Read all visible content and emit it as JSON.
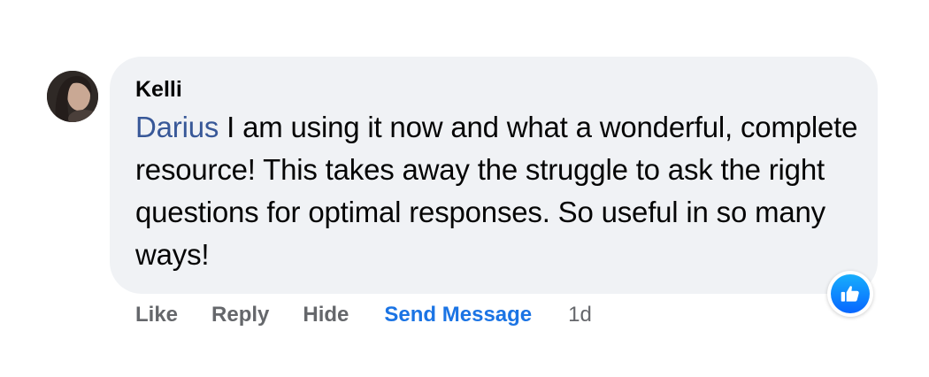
{
  "comment": {
    "author": "Kelli",
    "mention": "Darius",
    "text": " I am using it now and what a wonderful, complete resource! This takes away the struggle to ask the right questions for optimal responses. So useful in so many ways!",
    "reaction_icon": "thumbs-up-icon"
  },
  "actions": {
    "like": "Like",
    "reply": "Reply",
    "hide": "Hide",
    "send_message": "Send Message",
    "timestamp": "1d"
  },
  "colors": {
    "bubble_bg": "#f0f2f5",
    "mention": "#385898",
    "send_message": "#1b74e4",
    "muted_text": "#65676b",
    "like_badge": "#0766ff"
  }
}
